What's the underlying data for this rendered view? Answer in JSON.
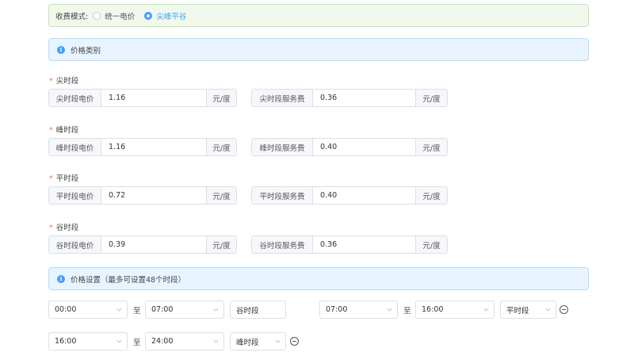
{
  "mode": {
    "label": "收费模式:",
    "options": [
      {
        "label": "统一电价",
        "checked": false
      },
      {
        "label": "尖峰平谷",
        "checked": true
      }
    ]
  },
  "price_category": {
    "title": "价格类别"
  },
  "periods": [
    {
      "name": "尖时段",
      "price_label": "尖时段电价",
      "price": "1.16",
      "price_unit": "元/度",
      "fee_label": "尖时段服务费",
      "fee": "0.36",
      "fee_unit": "元/度"
    },
    {
      "name": "峰时段",
      "price_label": "峰时段电价",
      "price": "1.16",
      "price_unit": "元/度",
      "fee_label": "峰时段服务费",
      "fee": "0.40",
      "fee_unit": "元/度"
    },
    {
      "name": "平时段",
      "price_label": "平时段电价",
      "price": "0.72",
      "price_unit": "元/度",
      "fee_label": "平时段服务费",
      "fee": "0.40",
      "fee_unit": "元/度"
    },
    {
      "name": "谷时段",
      "price_label": "谷时段电价",
      "price": "0.39",
      "price_unit": "元/度",
      "fee_label": "谷时段服务费",
      "fee": "0.36",
      "fee_unit": "元/度"
    }
  ],
  "price_settings": {
    "title": "价格设置（最多可设置48个时段）"
  },
  "time_slots": [
    {
      "start": "00:00",
      "to": "至",
      "end": "07:00",
      "period": "谷时段"
    },
    {
      "start": "07:00",
      "to": "至",
      "end": "16:00",
      "period": "平时段"
    },
    {
      "start": "16:00",
      "to": "至",
      "end": "24:00",
      "period": "峰时段"
    }
  ],
  "colors": {
    "accent": "#409eff",
    "success_bg": "#f0f9eb",
    "info_bg": "#e8f4ff",
    "required": "#f56c6c"
  }
}
